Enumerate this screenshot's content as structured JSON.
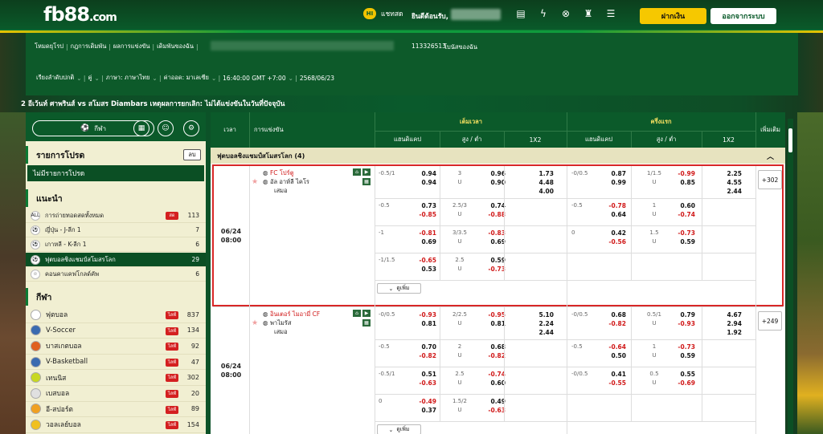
{
  "topbar": {
    "logo": "fb88",
    "logo_domain": ".com",
    "chat_label": "แชทสด",
    "chat_badge": "HI",
    "welcome": "ยินดีต้อนรับ,",
    "icons": [
      "wallet-icon",
      "lightning-icon",
      "sports-logo-icon",
      "trophy-icon",
      "list-icon"
    ],
    "deposit_label": "ฝากเงิน",
    "logout_label": "ออกจากระบบ"
  },
  "nav1": {
    "items": [
      "โหมดยุโรป",
      "กฎการเดิมพัน",
      "ผลการแข่งขัน",
      "เดิมพันของฉัน"
    ],
    "account": "113326513",
    "bonus": "โบนัสของฉัน"
  },
  "nav2": {
    "items": [
      "เรียงลำดับปกติ",
      "คู่",
      "ภาษา: ภาษาไทย",
      "ค่าออด: มาเลเซีย",
      "16:40:00 GMT +7:00",
      "2568/06/23"
    ]
  },
  "ticker": "2 อีเว้นท์ ศาพรินส์ vs สโมสร Diambars เหตุผลการยกเลิก: ไม่ได้แข่งขันในวันที่ปัจจุบัน",
  "left": {
    "sports_btn": "กีฬา",
    "fav_title": "รายการโปรด",
    "fav_del": "ลบ",
    "fav_empty": "ไม่มีรายการโปรด",
    "rec_title": "แนะนำ",
    "rec_items": [
      {
        "label": "การถ่ายทอดสดทั้งหมด",
        "count": "113",
        "live": "สด"
      },
      {
        "label": "ญี่ปุ่น - J-ลีก 1",
        "count": "7"
      },
      {
        "label": "เกาหลี - K-ลีก 1",
        "count": "6"
      },
      {
        "label": "ฟุตบอลชิงแชมป์สโมสรโลก",
        "count": "29"
      },
      {
        "label": "คอนคาแคฟโกลด์คัพ",
        "count": "6"
      }
    ],
    "sports_title": "กีฬา",
    "sports": [
      {
        "label": "ฟุตบอล",
        "count": "837",
        "color": "#ffffff"
      },
      {
        "label": "V-Soccer",
        "count": "134",
        "color": "#3a6ab0"
      },
      {
        "label": "บาสเกตบอล",
        "count": "92",
        "color": "#e06020"
      },
      {
        "label": "V-Basketball",
        "count": "47",
        "color": "#3a6ab0"
      },
      {
        "label": "เทนนิส",
        "count": "302",
        "color": "#c8d820"
      },
      {
        "label": "เบสบอล",
        "count": "20",
        "color": "#e0e0e0"
      },
      {
        "label": "อี-สปอร์ต",
        "count": "89",
        "color": "#f0a020"
      },
      {
        "label": "วอลเลย์บอล",
        "count": "154",
        "color": "#f0c020"
      }
    ],
    "live_label": "ไลฟ์"
  },
  "table": {
    "h_time": "เวลา",
    "h_match": "การแข่งขัน",
    "h_full": "เต็มเวลา",
    "h_half": "ครึ่งแรก",
    "h_more": "เพิ่มเติม",
    "h_hdp": "แฮนดิแคป",
    "h_ou": "สูง / ต่ำ",
    "h_1x2": "1X2",
    "league": "ฟุตบอลชิงแชมป์สโมสรโลก (4)",
    "more_label": "ดูเพิ่ม",
    "matches": [
      {
        "date": "06/24",
        "time": "08:00",
        "home": "FC โปร์ตู",
        "away": "อัล อาห์ลี ไคโร",
        "draw": "เสมอ",
        "more": "+302",
        "rows": [
          {
            "fh": "-0.5/1",
            "fa": "",
            "fhv": "0.94",
            "fav": "0.94",
            "fou": "3",
            "fu": "U",
            "fov": "0.96",
            "fuv": "0.90",
            "x1": "1.73",
            "x2": "4.48",
            "x3": "4.00",
            "hh": "-0/0.5",
            "hha": "",
            "hhv": "0.87",
            "hav": "0.99",
            "hou": "1/1.5",
            "hu": "U",
            "hov": "-0.99",
            "huv": "0.85",
            "y1": "2.25",
            "y2": "4.55",
            "y3": "2.44"
          },
          {
            "fh": "-0.5",
            "fhv": "0.73",
            "fav": "-0.85",
            "fou": "2.5/3",
            "fu": "U",
            "fov": "0.74",
            "fuv": "-0.88",
            "hh": "-0.5",
            "hhv": "-0.78",
            "hav": "0.64",
            "hou": "1",
            "hu": "U",
            "hov": "0.60",
            "huv": "-0.74"
          },
          {
            "fh": "-1",
            "fhv": "-0.81",
            "fav": "0.69",
            "fou": "3/3.5",
            "fu": "U",
            "fov": "-0.83",
            "fuv": "0.69",
            "hh": "0",
            "hhv": "0.42",
            "hav": "-0.56",
            "hou": "1.5",
            "hu": "U",
            "hov": "-0.73",
            "huv": "0.59"
          },
          {
            "fh": "-1/1.5",
            "fhv": "-0.65",
            "fav": "0.53",
            "fou": "2.5",
            "fu": "U",
            "fov": "0.59",
            "fuv": "-0.73"
          }
        ]
      },
      {
        "date": "06/24",
        "time": "08:00",
        "home": "อินเตอร์ ไมอามี่ CF",
        "away": "พาไมรัส",
        "draw": "เสมอ",
        "more": "+249",
        "rows": [
          {
            "fh": "-0/0.5",
            "fa": "",
            "fhv": "-0.93",
            "fav": "0.81",
            "fou": "2/2.5",
            "fu": "U",
            "fov": "-0.95",
            "fuv": "0.81",
            "x1": "5.10",
            "x2": "2.24",
            "x3": "2.44",
            "hh": "-0/0.5",
            "hhv": "0.68",
            "hav": "-0.82",
            "hou": "0.5/1",
            "hu": "U",
            "hov": "0.79",
            "huv": "-0.93",
            "y1": "4.67",
            "y2": "2.94",
            "y3": "1.92"
          },
          {
            "fh": "-0.5",
            "fhv": "0.70",
            "fav": "-0.82",
            "fou": "2",
            "fu": "U",
            "fov": "0.68",
            "fuv": "-0.82",
            "hh": "-0.5",
            "hhv": "-0.64",
            "hav": "0.50",
            "hou": "1",
            "hu": "U",
            "hov": "-0.73",
            "huv": "0.59"
          },
          {
            "fh": "-0.5/1",
            "fhv": "0.51",
            "fav": "-0.63",
            "fou": "2.5",
            "fu": "U",
            "fov": "-0.74",
            "fuv": "0.60",
            "hh": "-0/0.5",
            "hhv": "0.41",
            "hav": "-0.55",
            "hou": "0.5",
            "hu": "U",
            "hov": "0.55",
            "huv": "-0.69"
          },
          {
            "fh": "0",
            "fhv": "-0.49",
            "fav": "0.37",
            "fou": "1.5/2",
            "fu": "U",
            "fov": "0.49",
            "fuv": "-0.63"
          }
        ]
      }
    ]
  },
  "colors": {
    "green": "#0b5a2a",
    "yellow": "#f6c800",
    "red": "#d01818",
    "panel": "#f1efd2"
  }
}
